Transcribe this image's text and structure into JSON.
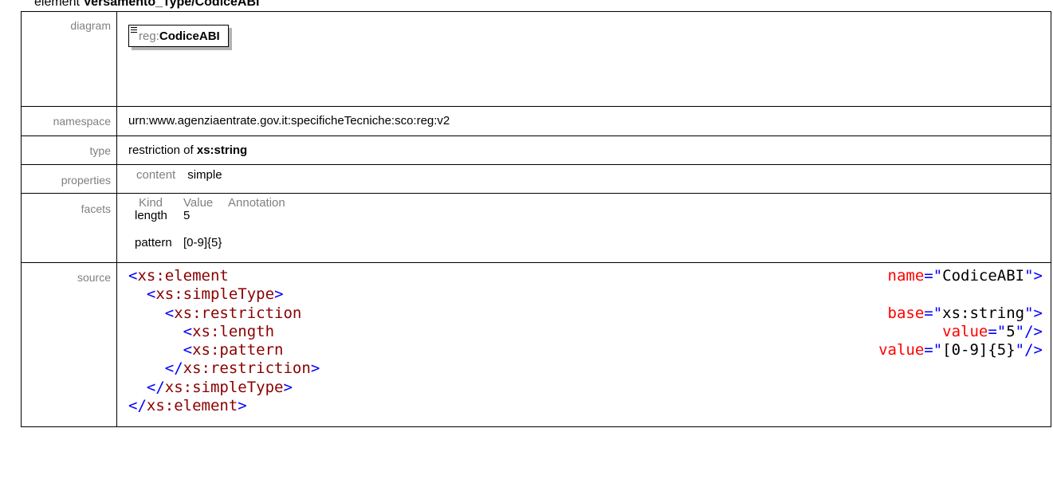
{
  "heading": {
    "prefix": "element ",
    "name": "Versamento_Type/CodiceABI"
  },
  "labels": {
    "diagram": "diagram",
    "namespace": "namespace",
    "type": "type",
    "properties": "properties",
    "facets": "facets",
    "source": "source"
  },
  "diagram": {
    "prefix": "reg:",
    "name": "CodiceABI"
  },
  "namespace": "urn:www.agenziaentrate.gov.it:specificheTecniche:sco:reg:v2",
  "type": {
    "prefix": "restriction of ",
    "base": "xs:string"
  },
  "properties": {
    "key": "content",
    "value": "simple"
  },
  "facets": {
    "headers": [
      "Kind",
      "Value",
      "Annotation"
    ],
    "rows": [
      {
        "kind": "length",
        "value": "5",
        "annotation": ""
      },
      {
        "kind": "pattern",
        "value": "[0-9]{5}",
        "annotation": ""
      }
    ]
  },
  "source": {
    "line1": {
      "open": "<",
      "tag": "xs:element",
      "attr": "name",
      "eq": "=\"",
      "val": "CodiceABI",
      "close": "\">"
    },
    "line2": {
      "open": "<",
      "tag": "xs:simpleType",
      "close": ">"
    },
    "line3": {
      "open": "<",
      "tag": "xs:restriction",
      "attr": "base",
      "eq": "=\"",
      "val": "xs:string",
      "close": "\">"
    },
    "line4": {
      "open": "<",
      "tag": "xs:length",
      "attr": "value",
      "eq": "=\"",
      "val": "5",
      "close": "\"/>"
    },
    "line5": {
      "open": "<",
      "tag": "xs:pattern",
      "attr": "value",
      "eq": "=\"",
      "val": "[0-9]{5}",
      "close": "\"/>"
    },
    "line6": {
      "open": "</",
      "tag": "xs:restriction",
      "close": ">"
    },
    "line7": {
      "open": "</",
      "tag": "xs:simpleType",
      "close": ">"
    },
    "line8": {
      "open": "</",
      "tag": "xs:element",
      "close": ">"
    }
  }
}
